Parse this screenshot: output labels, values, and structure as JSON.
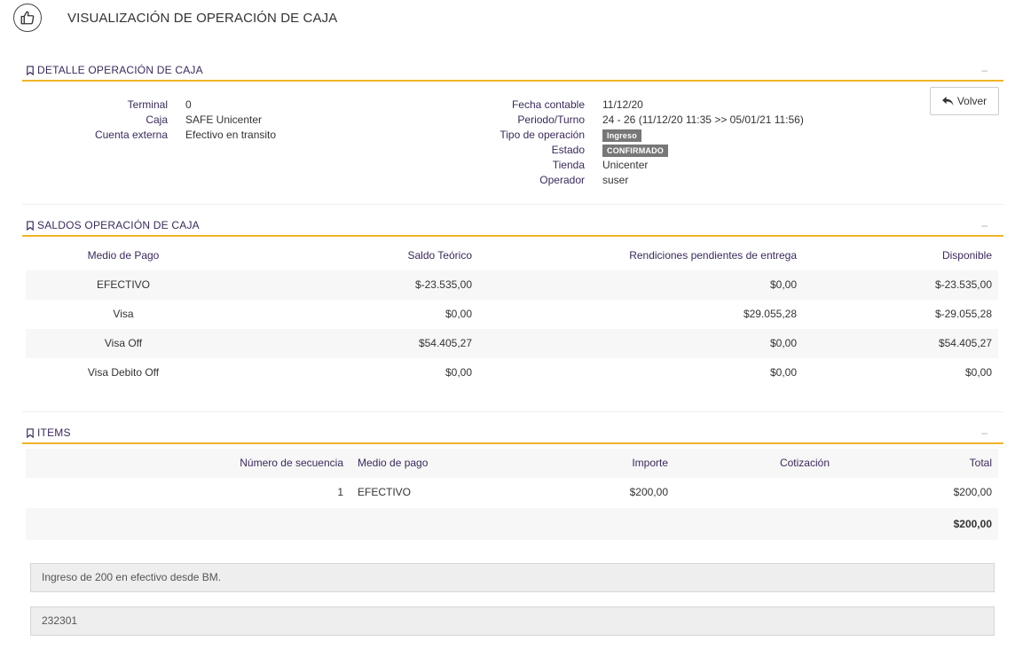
{
  "page": {
    "title": "VISUALIZACIÓN DE OPERACIÓN DE CAJA",
    "icon": "thumbs-up-icon"
  },
  "detalle": {
    "header": "DETALLE OPERACIÓN DE CAJA",
    "collapse": "–",
    "left": [
      {
        "label": "Terminal",
        "value": "0"
      },
      {
        "label": "Caja",
        "value": "SAFE Unicenter"
      },
      {
        "label": "Cuenta externa",
        "value": "Efectivo en transito"
      }
    ],
    "right": {
      "fecha_label": "Fecha contable",
      "fecha_value": "11/12/20",
      "periodo_label": "Periodo/Turno",
      "periodo_value": "24 - 26 (11/12/20 11:35 >> 05/01/21 11:56)",
      "tipo_label": "Tipo de operación",
      "tipo_value": "Ingreso",
      "estado_label": "Estado",
      "estado_value": "CONFIRMADO",
      "tienda_label": "Tienda",
      "tienda_value": "Unicenter",
      "operador_label": "Operador",
      "operador_value": "suser"
    },
    "volver_label": "Volver"
  },
  "saldos": {
    "header": "SALDOS OPERACIÓN DE CAJA",
    "collapse": "–",
    "columns": [
      "Medio de Pago",
      "Saldo Teórico",
      "Rendiciones pendientes de entrega",
      "Disponible"
    ],
    "rows": [
      [
        "EFECTIVO",
        "$-23.535,00",
        "$0,00",
        "$-23.535,00"
      ],
      [
        "Visa",
        "$0,00",
        "$29.055,28",
        "$-29.055,28"
      ],
      [
        "Visa Off",
        "$54.405,27",
        "$0,00",
        "$54.405,27"
      ],
      [
        "Visa Debito Off",
        "$0,00",
        "$0,00",
        "$0,00"
      ]
    ]
  },
  "items": {
    "header": "ITEMS",
    "collapse": "–",
    "columns": [
      "Número de secuencia",
      "Medio de pago",
      "Importe",
      "Cotización",
      "Total"
    ],
    "rows": [
      [
        "1",
        "EFECTIVO",
        "$200,00",
        "",
        "$200,00"
      ]
    ],
    "total": "$200,00"
  },
  "notes": {
    "observacion": "Ingreso de 200 en efectivo desde BM.",
    "referencia": "232301"
  }
}
